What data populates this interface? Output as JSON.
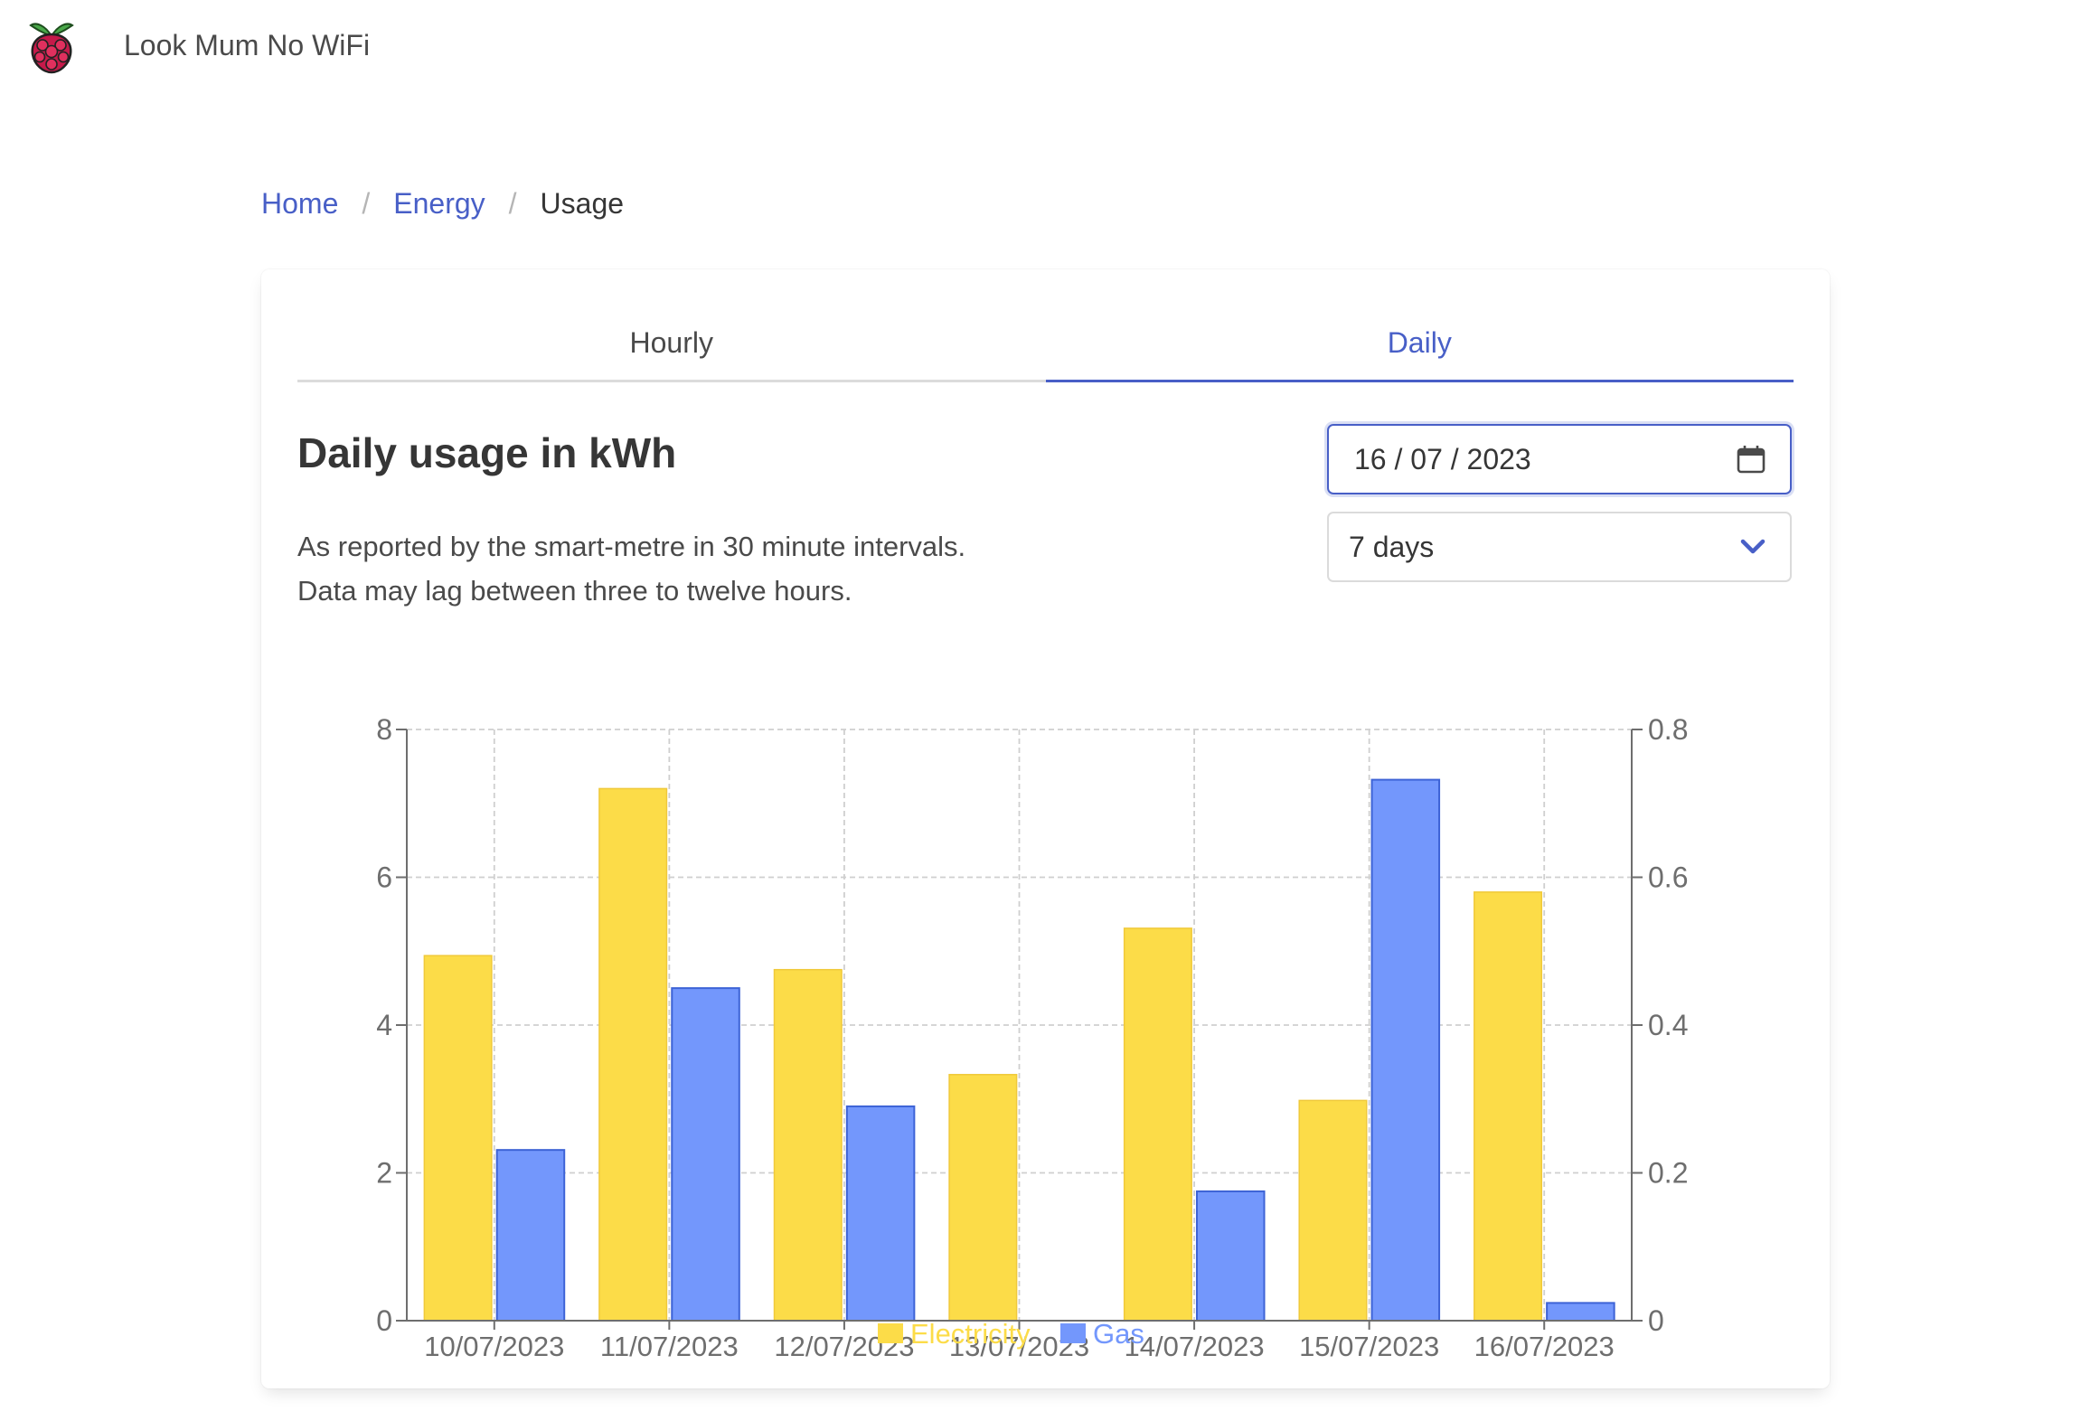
{
  "app": {
    "title": "Look Mum No WiFi",
    "logo_icon": "raspberry-pi-icon"
  },
  "breadcrumb": [
    {
      "label": "Home",
      "link": true
    },
    {
      "label": "Energy",
      "link": true
    },
    {
      "label": "Usage",
      "link": false
    }
  ],
  "tabs": [
    {
      "label": "Hourly",
      "active": false
    },
    {
      "label": "Daily",
      "active": true
    }
  ],
  "main": {
    "heading": "Daily usage in kWh",
    "description_lines": [
      "As reported by the smart-metre in 30 minute intervals.",
      "Data may lag between three to twelve hours."
    ]
  },
  "controls": {
    "date_value": "16 / 07 / 2023",
    "date_icon": "calendar-icon",
    "range_value": "7 days",
    "range_icon": "chevron-down-icon"
  },
  "colors": {
    "accent": "#485fc7",
    "electricity": "#fcdc48",
    "gas": "#7397fc"
  },
  "chart_data": {
    "type": "bar",
    "categories": [
      "10/07/2023",
      "11/07/2023",
      "12/07/2023",
      "13/07/2023",
      "14/07/2023",
      "15/07/2023",
      "16/07/2023"
    ],
    "series": [
      {
        "name": "Electricity",
        "axis": "left",
        "values": [
          4.94,
          7.2,
          4.75,
          3.33,
          5.31,
          2.98,
          5.8
        ]
      },
      {
        "name": "Gas",
        "axis": "right",
        "values": [
          0.231,
          0.45,
          0.29,
          0,
          0.175,
          0.732,
          0.024
        ]
      }
    ],
    "y_left": {
      "min": 0,
      "max": 8,
      "ticks": [
        "0",
        "2",
        "4",
        "6",
        "8"
      ]
    },
    "y_right": {
      "min": 0,
      "max": 0.8,
      "ticks": [
        "0",
        "0.2",
        "0.4",
        "0.6",
        "0.8"
      ]
    },
    "grid": true,
    "legend_position": "bottom"
  }
}
